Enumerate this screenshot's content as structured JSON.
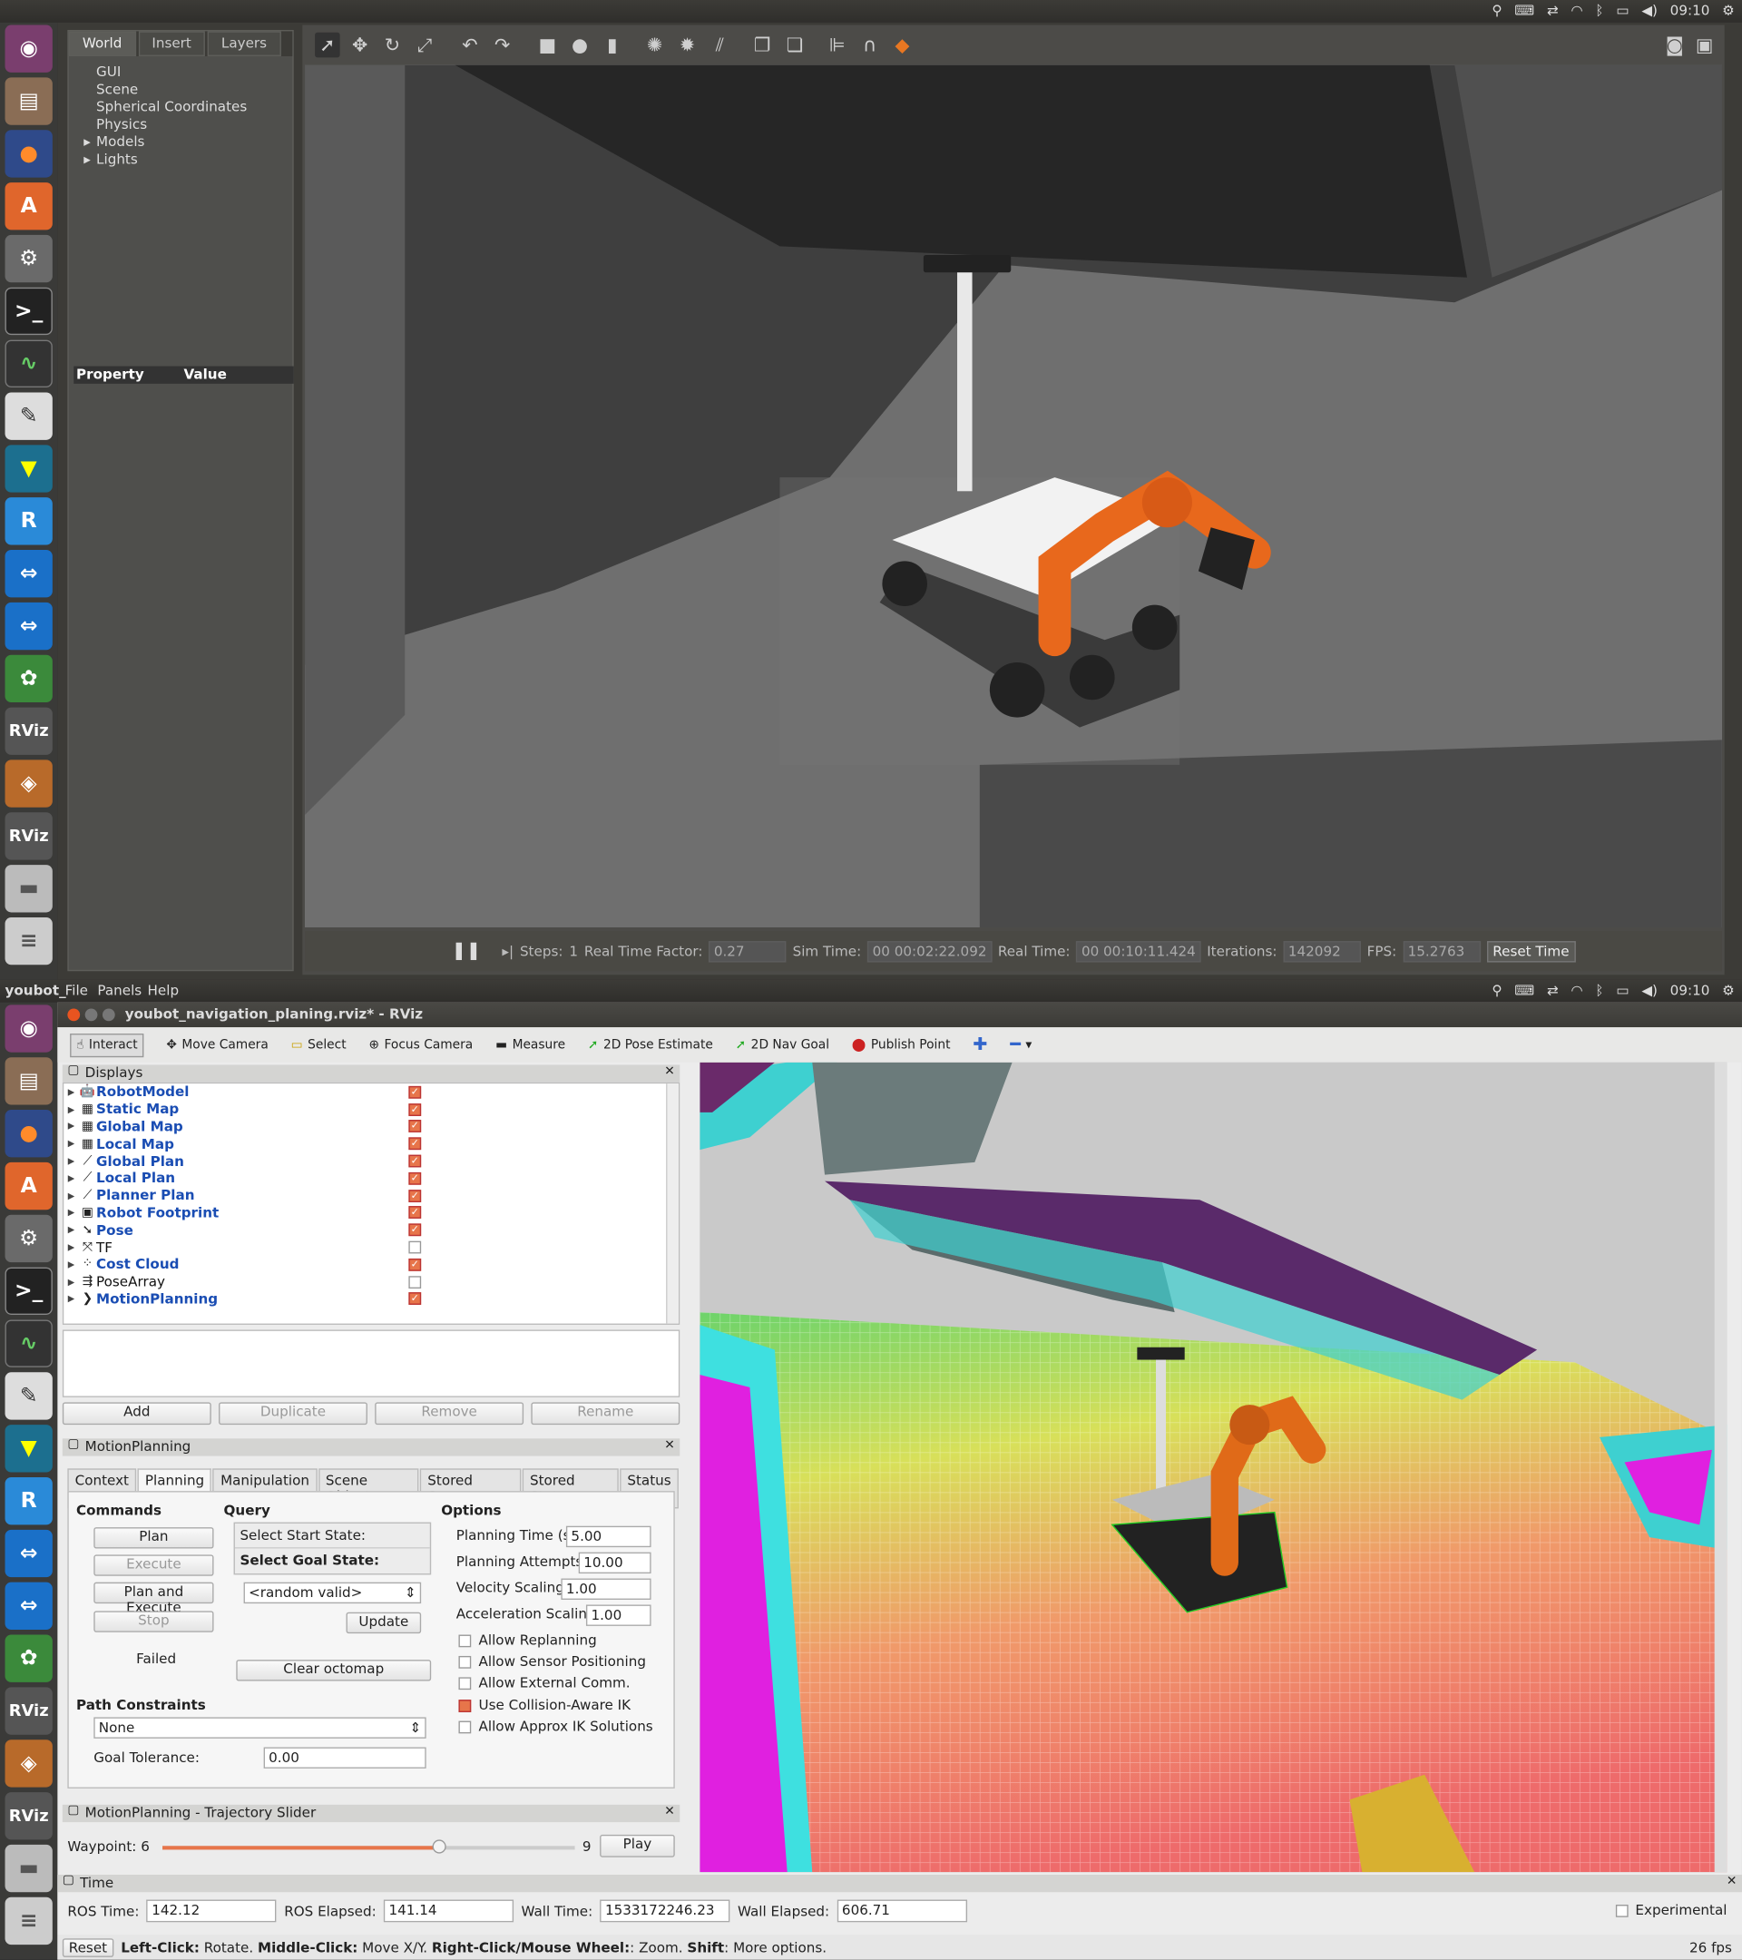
{
  "top_bar": {
    "clock": "09:10"
  },
  "launcher": {
    "icons": [
      "ubuntu-icon",
      "files-icon",
      "firefox-icon",
      "software-icon",
      "settings-icon",
      "terminal-icon",
      "system-monitor-icon",
      "text-editor-icon",
      "tools-icon",
      "robo-icon",
      "remote-icon",
      "remote-icon-2",
      "code-icon",
      "rviz-icon",
      "package-icon",
      "rviz-icon-2",
      "disks-icon",
      "stack-icon"
    ],
    "rviz_label": "RViz"
  },
  "gazebo": {
    "tabs": [
      "World",
      "Insert",
      "Layers"
    ],
    "tree": [
      "GUI",
      "Scene",
      "Spherical Coordinates",
      "Physics",
      "Models",
      "Lights"
    ],
    "prop_headers": {
      "property": "Property",
      "value": "Value"
    },
    "status": {
      "steps_label": "Steps:",
      "steps_value": "1",
      "rtf_label": "Real Time Factor:",
      "rtf_value": "0.27",
      "sim_label": "Sim Time:",
      "sim_value": "00 00:02:22.092",
      "real_label": "Real Time:",
      "real_value": "00 00:10:11.424",
      "iter_label": "Iterations:",
      "iter_value": "142092",
      "fps_label": "FPS:",
      "fps_value": "15.2763",
      "reset_label": "Reset Time"
    }
  },
  "rviz": {
    "menubar": {
      "app": "youbot_",
      "file": "File",
      "panels": "Panels",
      "help": "Help"
    },
    "title": "youbot_navigation_planing.rviz* - RViz",
    "tools": {
      "interact": "Interact",
      "move_camera": "Move Camera",
      "select": "Select",
      "focus_camera": "Focus Camera",
      "measure": "Measure",
      "pose_estimate": "2D Pose Estimate",
      "nav_goal": "2D Nav Goal",
      "publish_point": "Publish Point"
    },
    "displays": {
      "title": "Displays",
      "items": [
        {
          "name": "RobotModel",
          "checked": true
        },
        {
          "name": "Static Map",
          "checked": true
        },
        {
          "name": "Global Map",
          "checked": true
        },
        {
          "name": "Local Map",
          "checked": true
        },
        {
          "name": "Global Plan",
          "checked": true
        },
        {
          "name": "Local Plan",
          "checked": true
        },
        {
          "name": "Planner Plan",
          "checked": true
        },
        {
          "name": "Robot Footprint",
          "checked": true
        },
        {
          "name": "Pose",
          "checked": true
        },
        {
          "name": "TF",
          "checked": false
        },
        {
          "name": "Cost Cloud",
          "checked": true
        },
        {
          "name": "PoseArray",
          "checked": false
        },
        {
          "name": "MotionPlanning",
          "checked": true
        }
      ],
      "buttons": {
        "add": "Add",
        "duplicate": "Duplicate",
        "remove": "Remove",
        "rename": "Rename"
      }
    },
    "motion": {
      "title": "MotionPlanning",
      "tabs": [
        "Context",
        "Planning",
        "Manipulation",
        "Scene Objects",
        "Stored Scenes",
        "Stored States",
        "Status"
      ],
      "commands_label": "Commands",
      "plan": "Plan",
      "execute": "Execute",
      "plan_execute": "Plan and Execute",
      "stop": "Stop",
      "status": "Failed",
      "query_label": "Query",
      "start_state": "Select Start State:",
      "goal_state": "Select Goal State:",
      "goal_select": "<random valid>",
      "update": "Update",
      "clear_octomap": "Clear octomap",
      "options_label": "Options",
      "planning_time_label": "Planning Time (s):",
      "planning_time": "5.00",
      "planning_attempts_label": "Planning Attempts:",
      "planning_attempts": "10.00",
      "velocity_label": "Velocity Scaling:",
      "velocity": "1.00",
      "accel_label": "Acceleration Scaling:",
      "accel": "1.00",
      "opt_replanning": "Allow Replanning",
      "opt_sensor": "Allow Sensor Positioning",
      "opt_external": "Allow External Comm.",
      "opt_collision": "Use Collision-Aware IK",
      "opt_approx": "Allow Approx IK Solutions",
      "path_constraints_label": "Path Constraints",
      "path_constraints": "None",
      "goal_tolerance_label": "Goal Tolerance:",
      "goal_tolerance": "0.00"
    },
    "slider": {
      "title": "MotionPlanning - Trajectory Slider",
      "waypoint_label": "Waypoint:",
      "waypoint": "6",
      "max": "9",
      "play": "Play",
      "position": 0.67
    },
    "time": {
      "title": "Time",
      "ros_time_label": "ROS Time:",
      "ros_time": "142.12",
      "ros_elapsed_label": "ROS Elapsed:",
      "ros_elapsed": "141.14",
      "wall_time_label": "Wall Time:",
      "wall_time": "1533172246.23",
      "wall_elapsed_label": "Wall Elapsed:",
      "wall_elapsed": "606.71",
      "experimental": "Experimental"
    },
    "statusbar": {
      "reset": "Reset",
      "lc": "Left-Click:",
      "lc_d": " Rotate. ",
      "mc": "Middle-Click:",
      "mc_d": " Move X/Y. ",
      "rc": "Right-Click/Mouse Wheel:",
      "rc_d": ": Zoom. ",
      "sh": "Shift",
      "sh_d": ": More options.",
      "fps": "26 fps"
    }
  }
}
